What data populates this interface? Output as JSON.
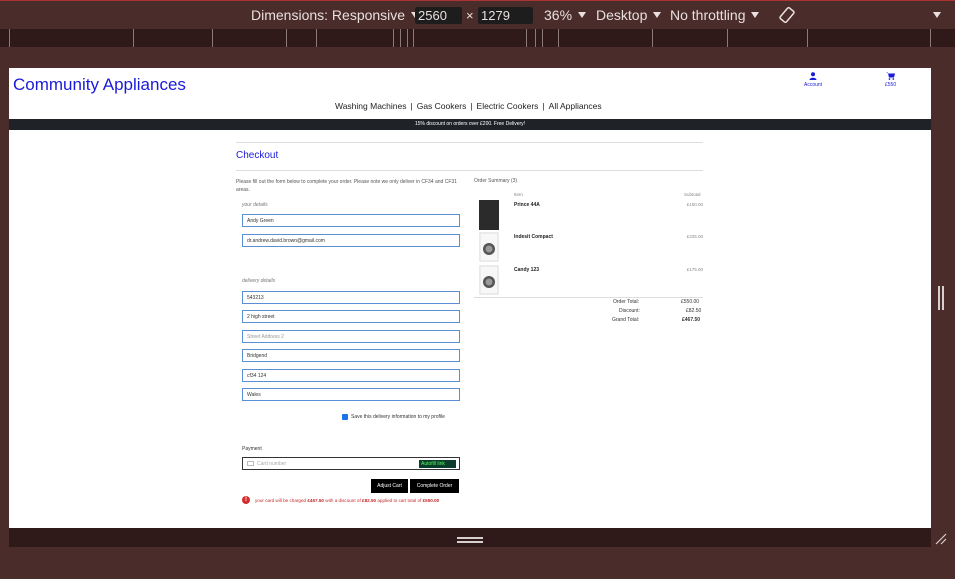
{
  "devtools": {
    "dimensions_label": "Dimensions: Responsive",
    "width": "2560",
    "times": "×",
    "height": "1279",
    "zoom": "36%",
    "device": "Desktop",
    "throttling": "No throttling"
  },
  "site": {
    "brand": "Community Appliances",
    "account_label": "Account",
    "cart_label": "£550",
    "nav": [
      "Washing Machines",
      "Gas Cookers",
      "Electric Cookers",
      "All Appliances"
    ],
    "banner": "15% discount on orders over £200. Free Delivery!"
  },
  "checkout": {
    "title": "Checkout",
    "intro": "Please fill out the form below to complete your order. Please note we only deliver in CF34 and CF31 areas.",
    "your_details_label": "your details",
    "name_value": "Andy Green",
    "email_value": "dr.andrew.david.brown@gmail.com",
    "delivery_label": "delivery details",
    "phone_value": "543213",
    "street1_value": "2 high street",
    "street2_placeholder": "Street Address 2",
    "town_value": "Bridgend",
    "postcode_value": "cf34 124",
    "county_value": "Wales",
    "save_label": "Save this delivery information to my profile",
    "payment_label": "Payment",
    "card_placeholder": "Card number",
    "link_label": "Autofill link",
    "adjust_cart": "Adjust Cart",
    "complete_order": "Complete Order",
    "warning_prefix": "your card will be charged",
    "warning_charge": "£467.50",
    "warning_mid": "with a discount of",
    "warning_discount": "£82.50",
    "warning_mid2": "applied to cart total of",
    "warning_total": "£550.00"
  },
  "summary": {
    "title": "Order Summary (3)",
    "col_item": "Item",
    "col_subtotal": "Subtotal",
    "items": [
      {
        "name": "Prince 44A",
        "price": "£150.00"
      },
      {
        "name": "Indesit Compact",
        "price": "£225.00"
      },
      {
        "name": "Candy 123",
        "price": "£175.00"
      }
    ],
    "order_total_label": "Order Total:",
    "order_total": "£550.00",
    "discount_label": "Discount:",
    "discount": "£82.50",
    "grand_total_label": "Grand Total:",
    "grand_total": "£467.50"
  }
}
